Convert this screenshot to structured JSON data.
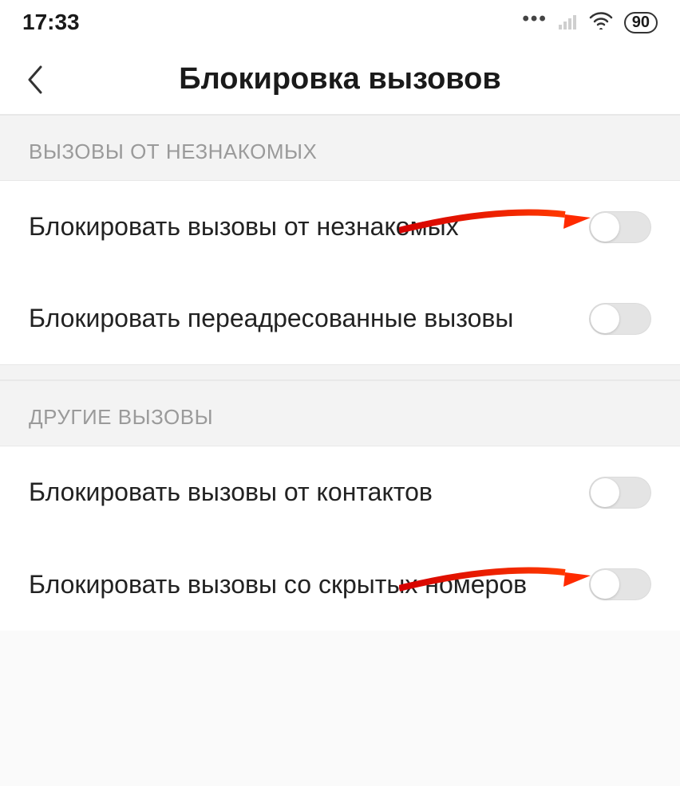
{
  "status": {
    "time": "17:33",
    "battery": "90"
  },
  "header": {
    "title": "Блокировка вызовов"
  },
  "sections": [
    {
      "header": "ВЫЗОВЫ ОТ НЕЗНАКОМЫХ",
      "rows": [
        {
          "label": "Блокировать вызовы от незнакомых",
          "on": false,
          "has_arrow": true
        },
        {
          "label": "Блокировать переадресованные вызовы",
          "on": false,
          "has_arrow": false
        }
      ]
    },
    {
      "header": "ДРУГИЕ ВЫЗОВЫ",
      "rows": [
        {
          "label": "Блокировать вызовы от контактов",
          "on": false,
          "has_arrow": false
        },
        {
          "label": "Блокировать вызовы со скрытых номеров",
          "on": false,
          "has_arrow": true
        }
      ]
    }
  ]
}
